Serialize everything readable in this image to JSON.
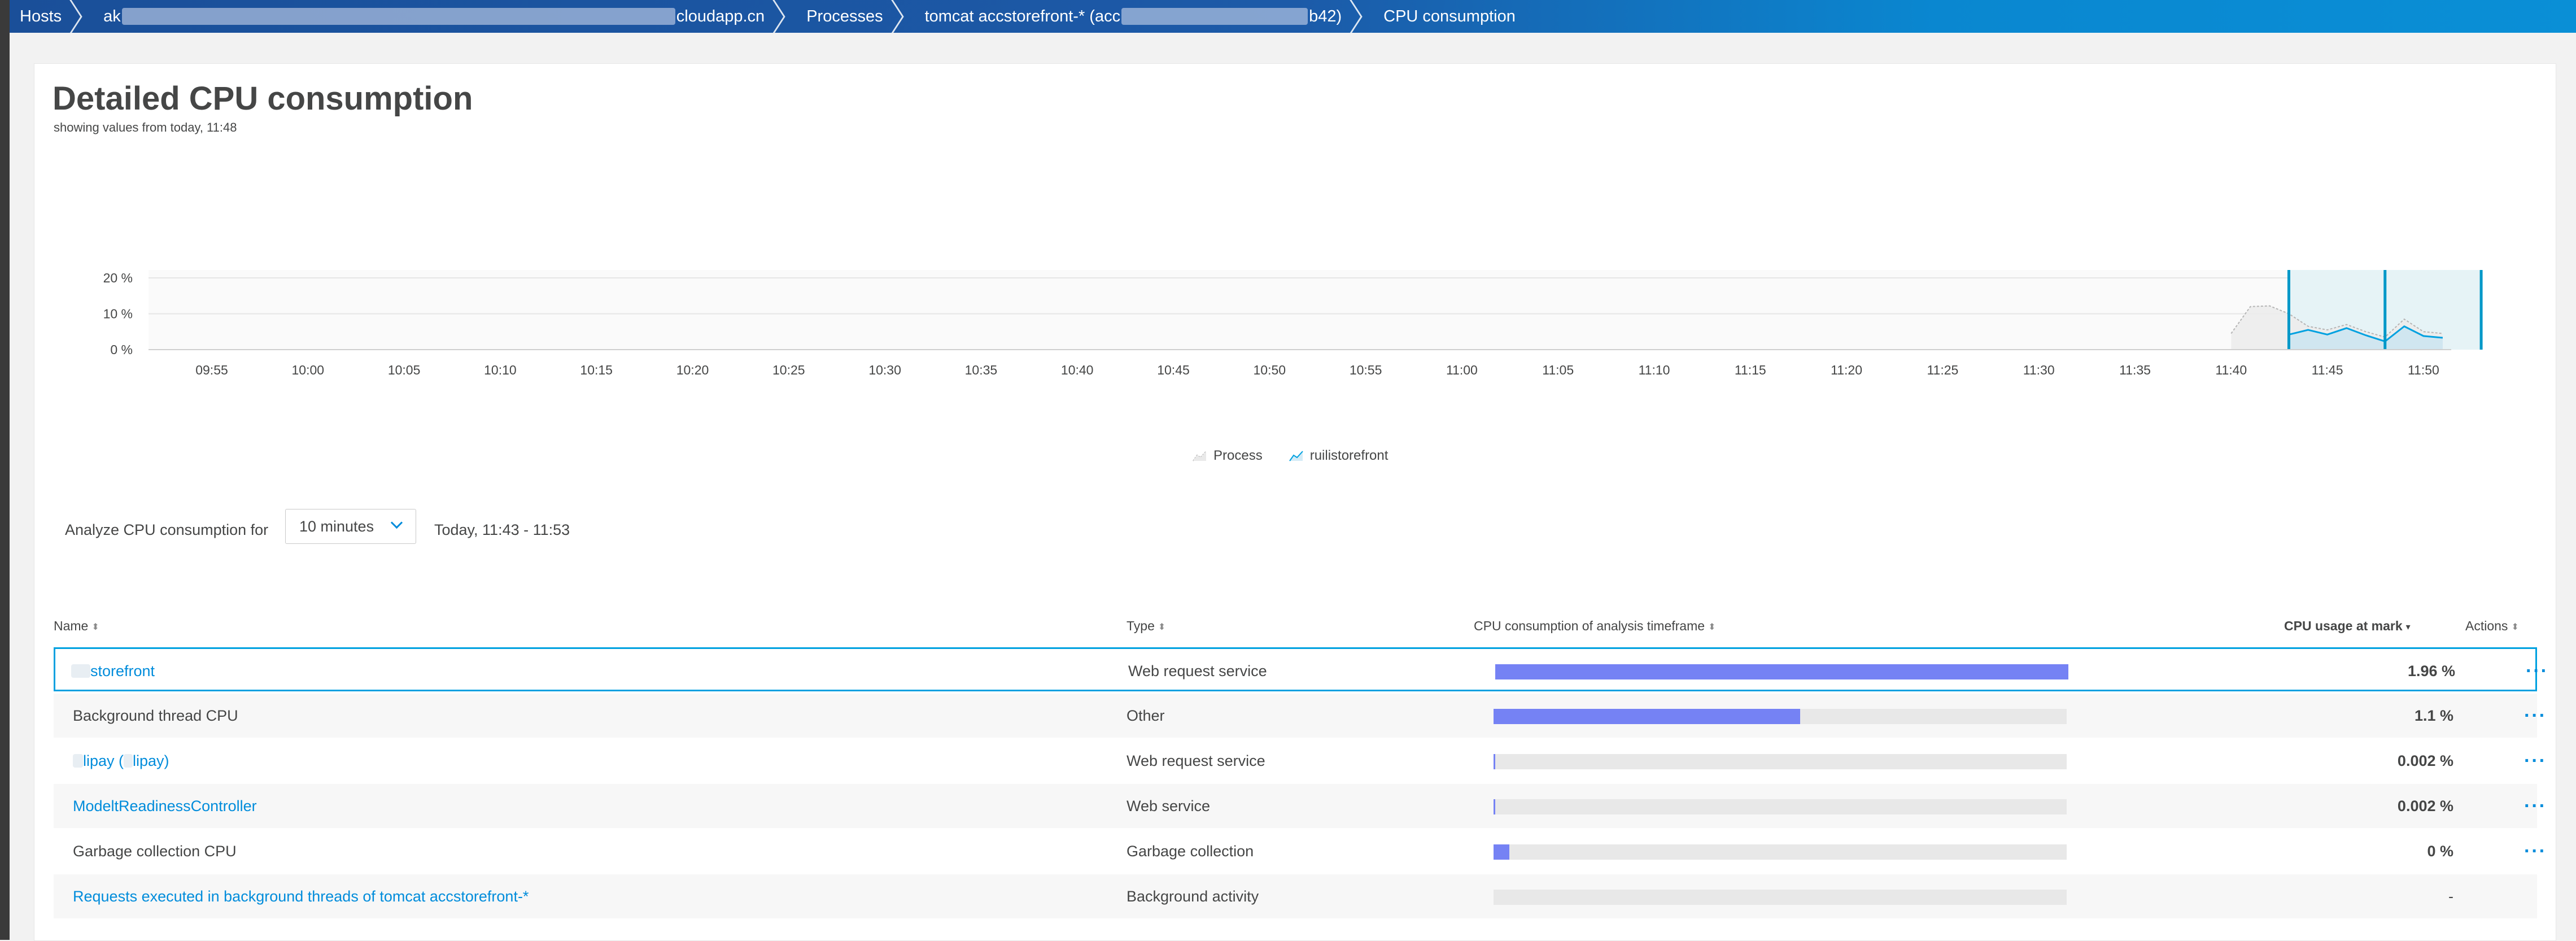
{
  "breadcrumbs": [
    {
      "label": "Hosts"
    },
    {
      "label": "ak",
      "suffix": "cloudapp.cn"
    },
    {
      "label": "Processes"
    },
    {
      "label": "tomcat accstorefront-* (acc",
      "suffix": "b42)"
    },
    {
      "label": "CPU consumption"
    }
  ],
  "page": {
    "title": "Detailed CPU consumption",
    "subtitle": "showing values from today, 11:48"
  },
  "analyze": {
    "label": "Analyze CPU consumption for",
    "timeframe": "10 minutes",
    "range": "Today, 11:43 - 11:53"
  },
  "chart_data": {
    "type": "area",
    "yticks": [
      "20 %",
      "10 %",
      "0 %"
    ],
    "ylim": [
      0,
      25
    ],
    "xticks": [
      "09:55",
      "10:00",
      "10:05",
      "10:10",
      "10:15",
      "10:20",
      "10:25",
      "10:30",
      "10:35",
      "10:40",
      "10:45",
      "10:50",
      "10:55",
      "11:00",
      "11:05",
      "11:10",
      "11:15",
      "11:20",
      "11:25",
      "11:30",
      "11:35",
      "11:40",
      "11:45",
      "11:50"
    ],
    "series": [
      {
        "name": "Process",
        "color": "#b5b5b5",
        "x": [
          "11:40",
          "11:41",
          "11:42",
          "11:43",
          "11:44",
          "11:45",
          "11:46",
          "11:47",
          "11:48",
          "11:49",
          "11:50",
          "11:51"
        ],
        "y": [
          4.5,
          12,
          12.2,
          10,
          6.5,
          5.5,
          7,
          5,
          3.5,
          8.5,
          5,
          4.5
        ]
      },
      {
        "name": "ruilistorefront",
        "color": "#00a1e0",
        "x": [
          "11:43",
          "11:44",
          "11:45",
          "11:46",
          "11:47",
          "11:48",
          "11:49",
          "11:50",
          "11:51"
        ],
        "y": [
          4.2,
          5.5,
          4.2,
          6,
          4,
          2.3,
          6.5,
          3.8,
          3.3
        ]
      }
    ],
    "selection": {
      "start": "11:43",
      "mark": "11:48",
      "end": "11:53"
    },
    "legend_position": "bottom-center"
  },
  "table": {
    "headers": {
      "name": "Name",
      "type": "Type",
      "consumption": "CPU consumption of analysis timeframe",
      "usage": "CPU usage at mark",
      "actions": "Actions"
    },
    "rows": [
      {
        "name": "storefront",
        "type": "Web request service",
        "fraction": 1.0,
        "usage": "1.96 %",
        "link": true,
        "actions": "···"
      },
      {
        "name": "Background thread CPU",
        "type": "Other",
        "fraction": 0.535,
        "usage": "1.1 %",
        "link": false,
        "actions": "···"
      },
      {
        "name": "lipay (",
        "name_tail": "lipay)",
        "type": "Web request service",
        "fraction": 0.003,
        "usage": "0.002 %",
        "link": true,
        "actions": "···"
      },
      {
        "name": "ModeltReadinessController",
        "type": "Web service",
        "fraction": 0.002,
        "usage": "0.002 %",
        "link": true,
        "actions": "···"
      },
      {
        "name": "Garbage collection CPU",
        "type": "Garbage collection",
        "fraction": 0.028,
        "usage": "0 %",
        "link": false,
        "actions": "···"
      },
      {
        "name": "Requests executed in background threads of tomcat accstorefront-*",
        "type": "Background activity",
        "fraction": 0,
        "usage": "-",
        "link": true,
        "actions": ""
      }
    ]
  }
}
